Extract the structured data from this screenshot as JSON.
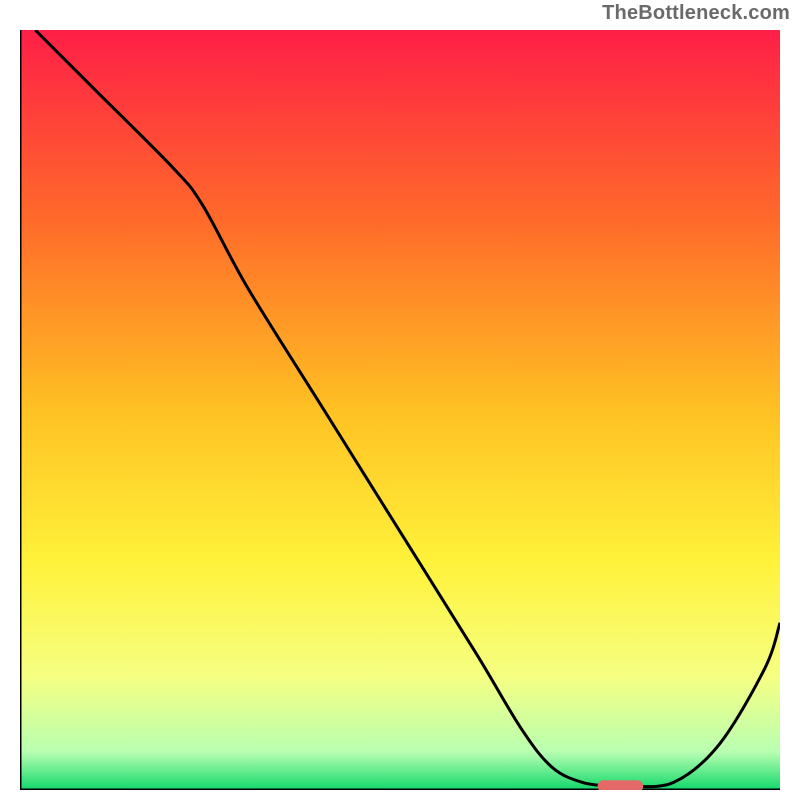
{
  "watermark": "TheBottleneck.com",
  "chart_data": {
    "type": "line",
    "title": "",
    "xlabel": "",
    "ylabel": "",
    "xlim": [
      0,
      100
    ],
    "ylim": [
      0,
      100
    ],
    "grid": false,
    "legend": false,
    "background_gradient": {
      "direction": "vertical",
      "stops": [
        {
          "pos": 0.0,
          "color": "#ff1f47"
        },
        {
          "pos": 0.25,
          "color": "#ff6a2a"
        },
        {
          "pos": 0.5,
          "color": "#ffc123"
        },
        {
          "pos": 0.7,
          "color": "#fff23a"
        },
        {
          "pos": 0.85,
          "color": "#f6ff82"
        },
        {
          "pos": 0.95,
          "color": "#b8ffb1"
        },
        {
          "pos": 1.0,
          "color": "#12d86b"
        }
      ]
    },
    "series": [
      {
        "name": "bottleneck-curve",
        "color": "#000000",
        "x": [
          2,
          10,
          20,
          24,
          30,
          40,
          50,
          60,
          66,
          70,
          74,
          78,
          80,
          86,
          92,
          98,
          100
        ],
        "y": [
          100,
          92,
          82,
          77,
          66,
          50,
          34,
          18,
          8,
          3,
          1,
          0.5,
          0.5,
          1,
          6,
          16,
          22
        ]
      }
    ],
    "marker": {
      "name": "optimal-range",
      "shape": "rounded-rect",
      "color": "#e46a6a",
      "x_range": [
        76,
        82
      ],
      "y": 0.5
    },
    "axes": {
      "color": "#000000",
      "show_ticks": false,
      "open_top": true,
      "open_right": true
    }
  }
}
